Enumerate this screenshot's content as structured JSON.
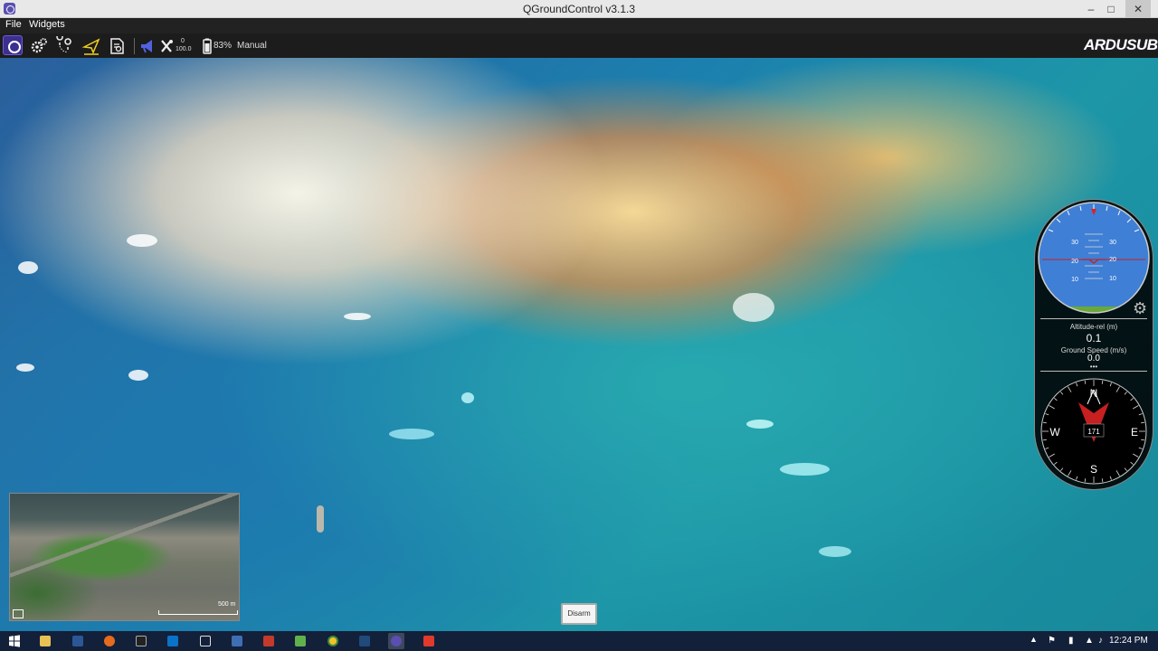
{
  "window": {
    "title": "QGroundControl v3.1.3"
  },
  "menu": {
    "file": "File",
    "widgets": "Widgets"
  },
  "toolbar": {
    "rc_top": "0",
    "rc_bottom": "100.0",
    "battery": "83%",
    "flight_mode": "Manual",
    "brand": "ARDUSUB"
  },
  "instruments": {
    "pitch_labels": [
      "30",
      "30",
      "20",
      "20",
      "10",
      "10"
    ],
    "altitude_label": "Altitude-rel (m)",
    "altitude_value": "0.1",
    "groundspeed_label": "Ground Speed (m/s)",
    "groundspeed_value": "0.0",
    "compass": {
      "n": "N",
      "e": "E",
      "s": "S",
      "w": "W",
      "heading": "171"
    }
  },
  "map": {
    "scale": "500 m"
  },
  "disarm_button": "Disarm",
  "taskbar": {
    "clock": "12:24 PM"
  },
  "colors": {
    "accent": "#6b5cd9",
    "horizon_sky": "#3f7fd6",
    "horizon_ground": "#6aa83a"
  }
}
